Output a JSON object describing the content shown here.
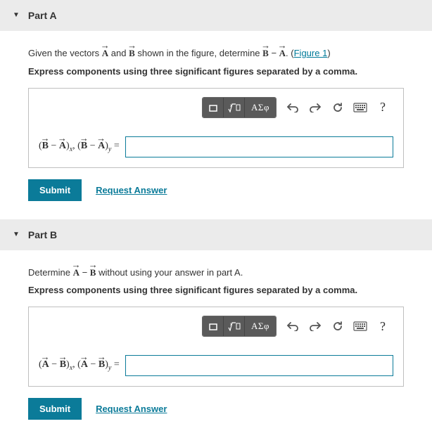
{
  "partA": {
    "header": "Part A",
    "prompt_pre": "Given the vectors ",
    "prompt_mid1": " and ",
    "prompt_mid2": " shown in the figure, determine ",
    "prompt_post": ". (",
    "figure_link": "Figure 1",
    "prompt_end": ")",
    "instruction": "Express components using three significant figures separated by a comma.",
    "toolbar_sym": "ΑΣφ",
    "equals": " =",
    "submit": "Submit",
    "request": "Request Answer"
  },
  "partB": {
    "header": "Part B",
    "prompt_pre": "Determine ",
    "prompt_post": " without using your answer in part A.",
    "instruction": "Express components using three significant figures separated by a comma.",
    "toolbar_sym": "ΑΣφ",
    "equals": " =",
    "submit": "Submit",
    "request": "Request Answer"
  }
}
